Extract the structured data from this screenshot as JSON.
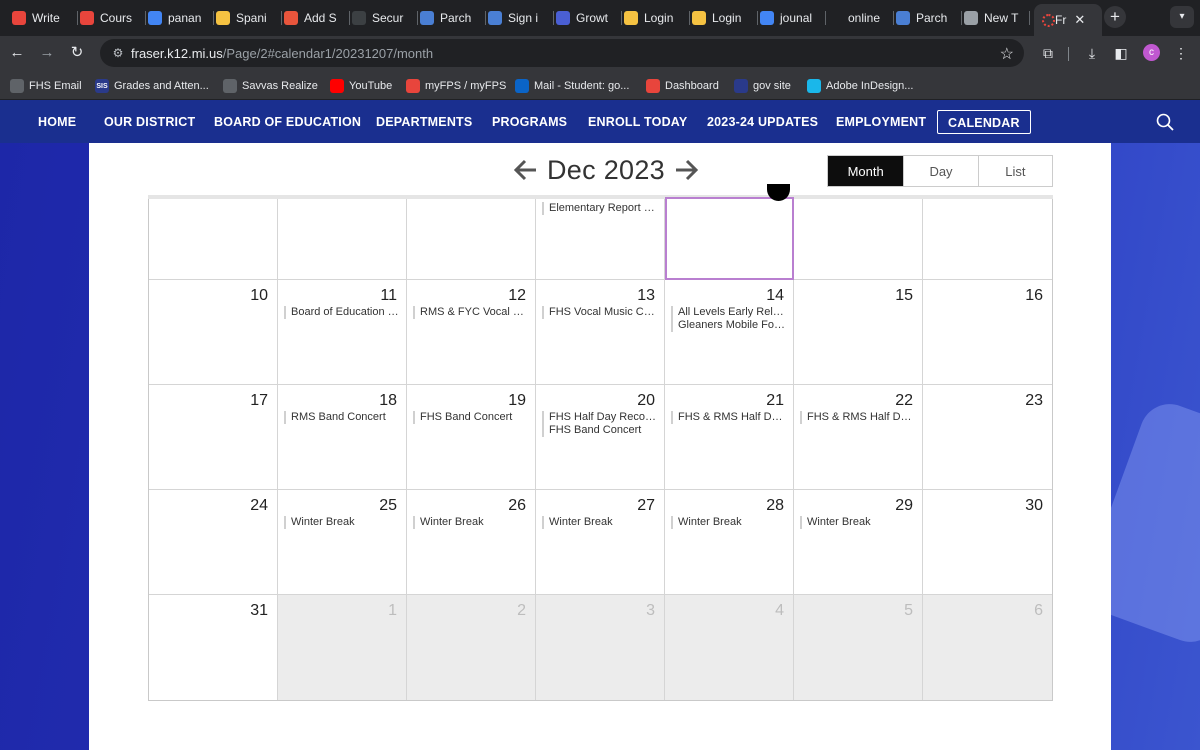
{
  "browser": {
    "tabs": [
      {
        "label": "Write",
        "icon": "brand-ring-icon",
        "color": "#e8453c"
      },
      {
        "label": "Cours",
        "icon": "brand-ring-icon",
        "color": "#e8453c"
      },
      {
        "label": "panan",
        "icon": "google-icon",
        "color": "#4285f4"
      },
      {
        "label": "Spani",
        "icon": "target-icon",
        "color": "#f5c242"
      },
      {
        "label": "Add S",
        "icon": "flame-icon",
        "color": "#e8553c"
      },
      {
        "label": "Secur",
        "icon": "terminal-icon",
        "color": "#3c4043"
      },
      {
        "label": "Parch",
        "icon": "parchment-icon",
        "color": "#4a7fd4"
      },
      {
        "label": "Sign i",
        "icon": "parchment-circle-icon",
        "color": "#4a7fd4"
      },
      {
        "label": "Growt",
        "icon": "growth-icon",
        "color": "#4a5fd4"
      },
      {
        "label": "Login",
        "icon": "login-w-icon",
        "color": "#f5c242"
      },
      {
        "label": "Login",
        "icon": "login-w-icon",
        "color": "#f5c242"
      },
      {
        "label": "jounal",
        "icon": "docs-icon",
        "color": "#4285f4"
      },
      {
        "label": "online",
        "icon": "e-icon",
        "color": "#202124"
      },
      {
        "label": "Parch",
        "icon": "parchment-icon",
        "color": "#4a7fd4"
      },
      {
        "label": "New T",
        "icon": "chrome-icon",
        "color": "#9aa0a6"
      }
    ],
    "active_tab": {
      "label": "Fr",
      "icon": "brand-ring-icon"
    },
    "url_host": "fraser.k12.mi.us",
    "url_path": "/Page/2#calendar1/20231207/month",
    "profile_initial": "c",
    "bookmarks": [
      {
        "label": "FHS Email",
        "icon": "globe-icon",
        "color": "#5f6368"
      },
      {
        "label": "Grades and Atten...",
        "icon": "sis-icon",
        "color": "#2a3a8a",
        "text": "SIS"
      },
      {
        "label": "Savvas Realize",
        "icon": "globe-icon",
        "color": "#5f6368"
      },
      {
        "label": "YouTube",
        "icon": "youtube-icon",
        "color": "#ff0000"
      },
      {
        "label": "myFPS / myFPS",
        "icon": "brand-ring-icon",
        "color": "#e8453c"
      },
      {
        "label": "Mail - Student: go...",
        "icon": "outlook-icon",
        "color": "#0a64c8"
      },
      {
        "label": "Dashboard",
        "icon": "brand-ring-icon",
        "color": "#e8453c"
      },
      {
        "label": "gov site",
        "icon": "gov-icon",
        "color": "#2a3a8a"
      },
      {
        "label": "Adobe InDesign...",
        "icon": "vimeo-icon",
        "color": "#1ab7ea"
      }
    ]
  },
  "site_nav": {
    "items": [
      "HOME",
      "OUR DISTRICT",
      "BOARD OF EDUCATION",
      "DEPARTMENTS",
      "PROGRAMS",
      "ENROLL TODAY",
      "2023-24 UPDATES",
      "EMPLOYMENT",
      "CALENDAR"
    ],
    "active": "CALENDAR"
  },
  "calendar": {
    "month_label": "Dec 2023",
    "views": [
      "Month",
      "Day",
      "List"
    ],
    "active_view": "Month",
    "weeks": [
      [
        {
          "day": "",
          "events": []
        },
        {
          "day": "",
          "events": []
        },
        {
          "day": "",
          "events": []
        },
        {
          "day": "",
          "events": [
            "Elementary Report Ca..."
          ]
        },
        {
          "day": "",
          "events": []
        },
        {
          "day": "",
          "events": []
        },
        {
          "day": "",
          "events": []
        }
      ],
      [
        {
          "day": "10",
          "events": []
        },
        {
          "day": "11",
          "events": [
            "Board of Education M..."
          ]
        },
        {
          "day": "12",
          "events": [
            "RMS & FYC Vocal Musi..."
          ]
        },
        {
          "day": "13",
          "events": [
            "FHS Vocal Music Conc..."
          ]
        },
        {
          "day": "14",
          "events": [
            "All Levels Early Releas...",
            "Gleaners Mobile Food..."
          ]
        },
        {
          "day": "15",
          "events": []
        },
        {
          "day": "16",
          "events": []
        }
      ],
      [
        {
          "day": "17",
          "events": []
        },
        {
          "day": "18",
          "events": [
            "RMS Band Concert"
          ]
        },
        {
          "day": "19",
          "events": [
            "FHS Band Concert"
          ]
        },
        {
          "day": "20",
          "events": [
            "FHS Half Day Records",
            "FHS Band Concert"
          ]
        },
        {
          "day": "21",
          "events": [
            "FHS & RMS Half Day R..."
          ]
        },
        {
          "day": "22",
          "events": [
            "FHS & RMS Half Day R..."
          ]
        },
        {
          "day": "23",
          "events": []
        }
      ],
      [
        {
          "day": "24",
          "events": []
        },
        {
          "day": "25",
          "events": [
            "Winter Break"
          ]
        },
        {
          "day": "26",
          "events": [
            "Winter Break"
          ]
        },
        {
          "day": "27",
          "events": [
            "Winter Break"
          ]
        },
        {
          "day": "28",
          "events": [
            "Winter Break"
          ]
        },
        {
          "day": "29",
          "events": [
            "Winter Break"
          ]
        },
        {
          "day": "30",
          "events": []
        }
      ],
      [
        {
          "day": "31",
          "events": [],
          "other": false
        },
        {
          "day": "1",
          "events": [],
          "other": true
        },
        {
          "day": "2",
          "events": [],
          "other": true
        },
        {
          "day": "3",
          "events": [],
          "other": true
        },
        {
          "day": "4",
          "events": [],
          "other": true
        },
        {
          "day": "5",
          "events": [],
          "other": true
        },
        {
          "day": "6",
          "events": [],
          "other": true
        }
      ]
    ]
  }
}
